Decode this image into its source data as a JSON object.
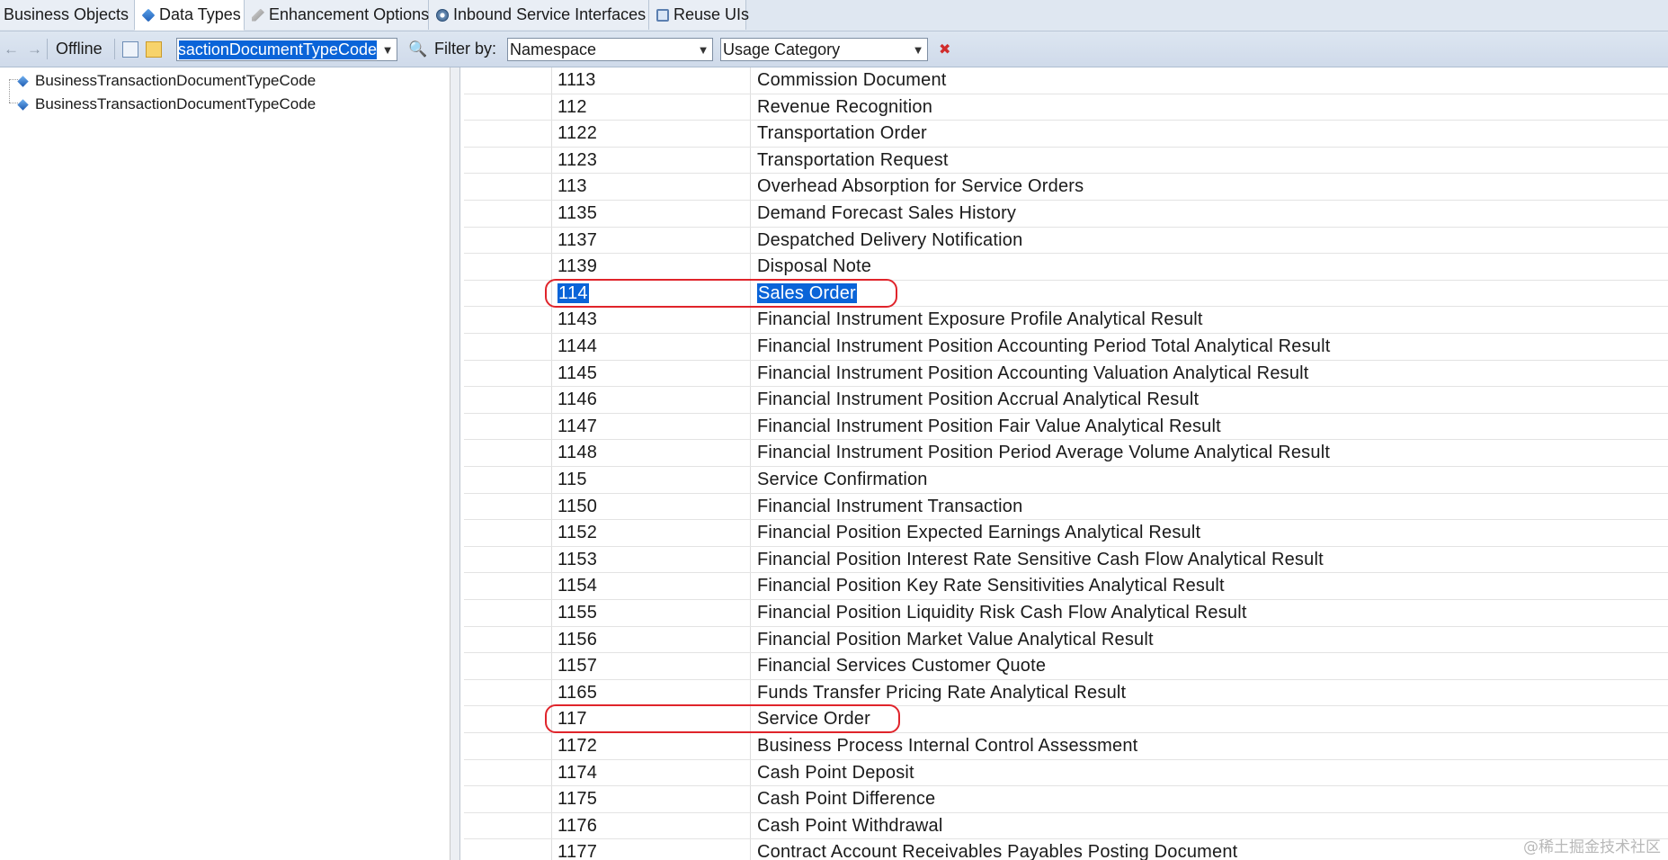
{
  "tabs": [
    {
      "label": "Business Objects",
      "icon": "cube-icon"
    },
    {
      "label": "Data Types",
      "icon": "cube-icon",
      "active": true
    },
    {
      "label": "Enhancement Options",
      "icon": "pen-icon"
    },
    {
      "label": "Inbound Service Interfaces",
      "icon": "gear-icon"
    },
    {
      "label": "Reuse UIs",
      "icon": "ui-icon"
    }
  ],
  "toolbar": {
    "back_icon": "←",
    "forward_icon": "→",
    "offline_label": "Offline",
    "search_value": "BusinessTransactionDocumentTypeCode",
    "filter_label": "Filter by:",
    "namespace_value": "Namespace",
    "usage_category_value": "Usage Category"
  },
  "tree": {
    "items": [
      {
        "label": "BusinessTransactionDocumentTypeCode"
      },
      {
        "label": "BusinessTransactionDocumentTypeCode"
      }
    ]
  },
  "grid": {
    "rows": [
      {
        "code": "1113",
        "description": "Commission Document"
      },
      {
        "code": "112",
        "description": "Revenue Recognition"
      },
      {
        "code": "1122",
        "description": "Transportation Order"
      },
      {
        "code": "1123",
        "description": "Transportation Request"
      },
      {
        "code": "113",
        "description": "Overhead Absorption for Service Orders"
      },
      {
        "code": "1135",
        "description": "Demand Forecast Sales History"
      },
      {
        "code": "1137",
        "description": "Despatched Delivery Notification"
      },
      {
        "code": "1139",
        "description": "Disposal Note"
      },
      {
        "code": "114",
        "description": "Sales Order",
        "selected": true,
        "highlighted": true
      },
      {
        "code": "1143",
        "description": "Financial Instrument Exposure Profile Analytical Result"
      },
      {
        "code": "1144",
        "description": "Financial Instrument Position Accounting Period Total Analytical Result"
      },
      {
        "code": "1145",
        "description": "Financial Instrument Position Accounting Valuation Analytical Result"
      },
      {
        "code": "1146",
        "description": "Financial Instrument Position Accrual Analytical Result"
      },
      {
        "code": "1147",
        "description": "Financial Instrument Position Fair Value Analytical Result"
      },
      {
        "code": "1148",
        "description": "Financial Instrument Position Period Average Volume Analytical Result"
      },
      {
        "code": "115",
        "description": "Service Confirmation"
      },
      {
        "code": "1150",
        "description": "Financial Instrument Transaction"
      },
      {
        "code": "1152",
        "description": "Financial Position Expected Earnings Analytical Result"
      },
      {
        "code": "1153",
        "description": "Financial Position Interest Rate Sensitive Cash Flow Analytical Result"
      },
      {
        "code": "1154",
        "description": "Financial Position Key Rate Sensitivities Analytical Result"
      },
      {
        "code": "1155",
        "description": "Financial Position Liquidity Risk Cash Flow Analytical Result"
      },
      {
        "code": "1156",
        "description": "Financial Position Market Value Analytical Result"
      },
      {
        "code": "1157",
        "description": "Financial Services Customer Quote"
      },
      {
        "code": "1165",
        "description": "Funds Transfer Pricing Rate Analytical Result"
      },
      {
        "code": "117",
        "description": "Service Order",
        "highlighted": true
      },
      {
        "code": "1172",
        "description": "Business Process Internal Control Assessment"
      },
      {
        "code": "1174",
        "description": "Cash Point Deposit"
      },
      {
        "code": "1175",
        "description": "Cash Point Difference"
      },
      {
        "code": "1176",
        "description": "Cash Point Withdrawal"
      },
      {
        "code": "1177",
        "description": "Contract Account Receivables Payables Posting Document"
      }
    ]
  },
  "colors": {
    "selection": "#0a64d8",
    "highlight_border": "#e0242b",
    "toolbar_bg": "#d5dfec"
  },
  "watermark": "@稀土掘金技术社区"
}
